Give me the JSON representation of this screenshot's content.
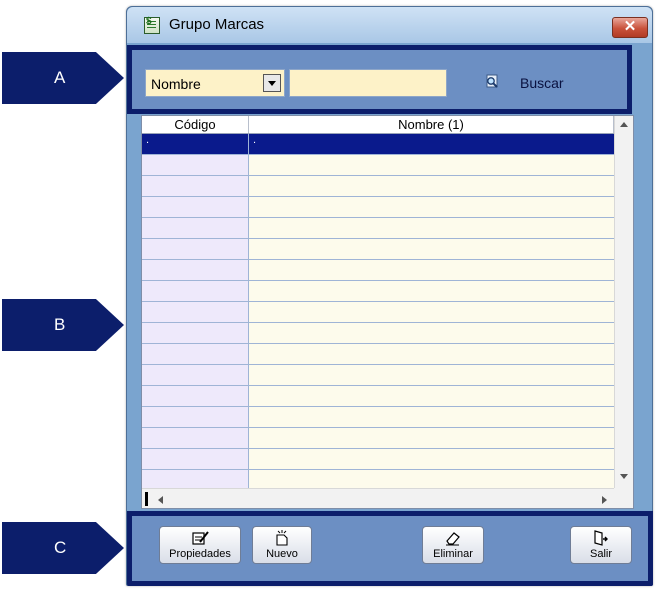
{
  "callouts": {
    "a": "A",
    "b": "B",
    "c": "C"
  },
  "window": {
    "title": "Grupo Marcas",
    "close_label": "✕"
  },
  "search": {
    "field_value": "Nombre",
    "query_value": "",
    "buscar_label": "Buscar"
  },
  "grid": {
    "columns": [
      "Código",
      "Nombre (1)"
    ],
    "rows": [
      [
        ".",
        "."
      ],
      [
        "",
        ""
      ],
      [
        "",
        ""
      ],
      [
        "",
        ""
      ],
      [
        "",
        ""
      ],
      [
        "",
        ""
      ],
      [
        "",
        ""
      ],
      [
        "",
        ""
      ],
      [
        "",
        ""
      ],
      [
        "",
        ""
      ],
      [
        "",
        ""
      ],
      [
        "",
        ""
      ],
      [
        "",
        ""
      ],
      [
        "",
        ""
      ],
      [
        "",
        ""
      ],
      [
        "",
        ""
      ],
      [
        "",
        ""
      ]
    ],
    "selected_row": 0
  },
  "buttons": {
    "propiedades": "Propiedades",
    "nuevo": "Nuevo",
    "eliminar": "Eliminar",
    "salir": "Salir"
  },
  "colors": {
    "callout": "#0c1e6b",
    "panel": "#6c8fc3",
    "selected_row": "#0a1a8c",
    "cell_bg": "#fdfbec"
  },
  "icons": [
    "app-icon",
    "close-icon",
    "dropdown-arrow-icon",
    "search-icon",
    "properties-icon",
    "new-icon",
    "eraser-icon",
    "exit-icon"
  ]
}
